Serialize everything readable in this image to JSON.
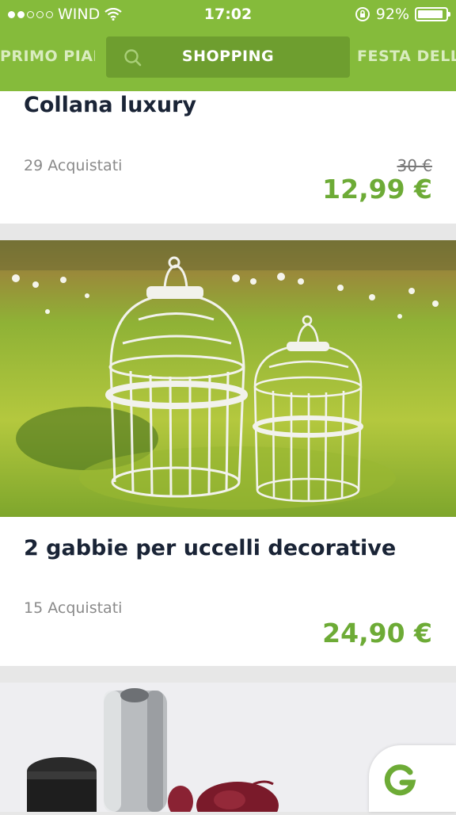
{
  "status_bar": {
    "carrier": "WIND",
    "time": "17:02",
    "battery": "92%",
    "battery_level": 0.92
  },
  "tabs": {
    "prev_label": "PRIMO PIANO",
    "active_label": "SHOPPING",
    "next_label": "FESTA DELLA"
  },
  "deals": [
    {
      "title": "Collana luxury",
      "purchased": "29 Acquistati",
      "old_price": "30 €",
      "price": "12,99 €"
    },
    {
      "title": "2 gabbie per uccelli decorative",
      "purchased": "15 Acquistati",
      "price": "24,90 €"
    }
  ],
  "colors": {
    "brand_green": "#85bb3b",
    "active_tab": "#6e9e2f",
    "price_green": "#6dab36",
    "title_navy": "#1a2436"
  },
  "icons": [
    "signal-dots-icon",
    "wifi-icon",
    "rotation-lock-icon",
    "battery-icon",
    "search-icon",
    "groupon-g-icon"
  ]
}
